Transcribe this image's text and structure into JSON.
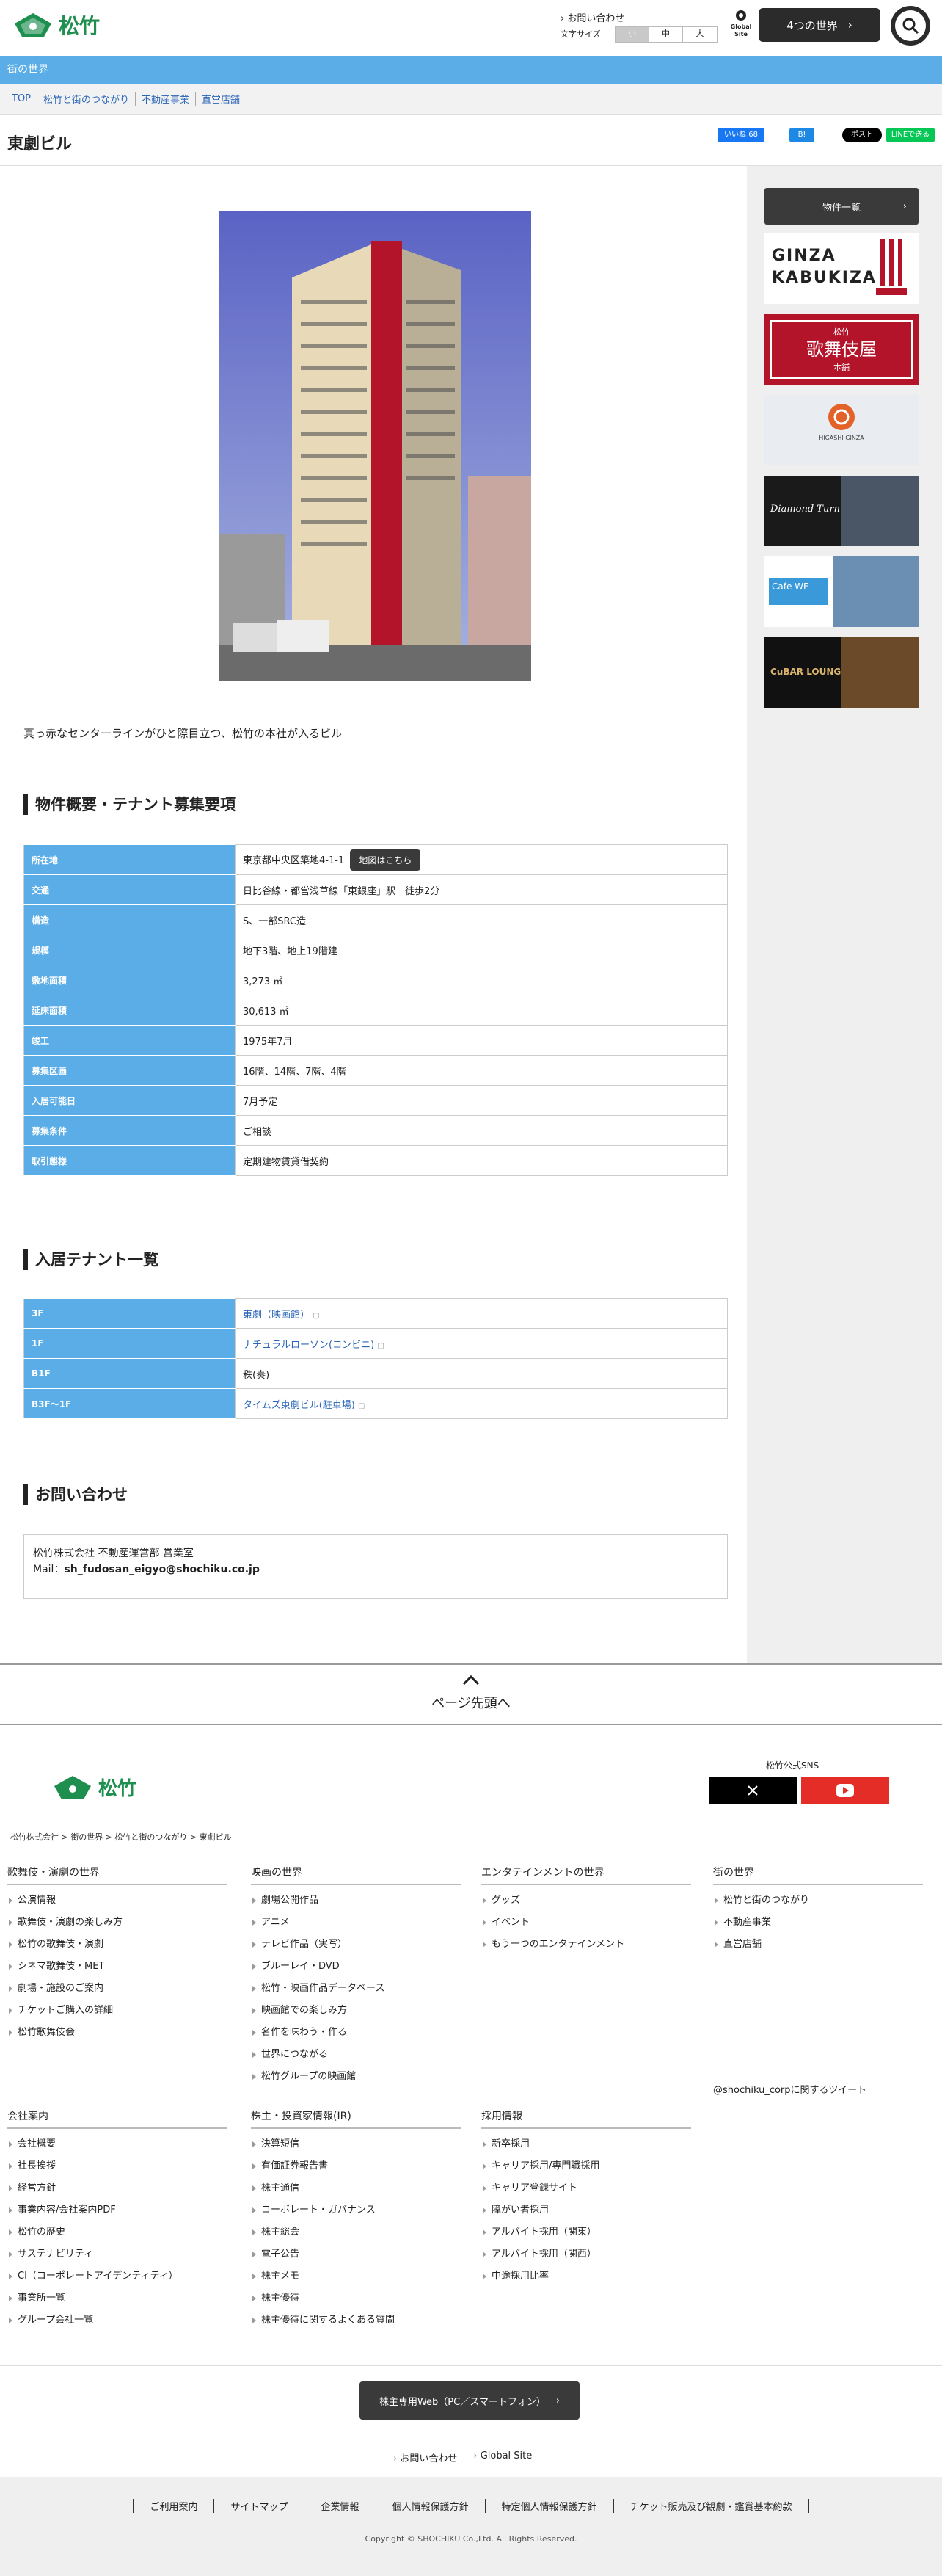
{
  "header": {
    "logo_text": "松竹",
    "contact_label": "お問い合わせ",
    "font_size_label": "文字サイズ",
    "font_sizes": [
      "小",
      "中",
      "大"
    ],
    "global_label_1": "Global",
    "global_label_2": "Site",
    "worlds_label": "4つの世界"
  },
  "band": {
    "title": "街の世界"
  },
  "breadcrumb": [
    "TOP",
    "松竹と街のつながり",
    "不動産事業",
    "直営店舗"
  ],
  "page": {
    "title": "東劇ビル"
  },
  "share": {
    "facebook": "いいね 68",
    "hatena": "B!",
    "twitter": "ポスト",
    "line": "LINEで送る"
  },
  "lead": "真っ赤なセンターラインがひと際目立つ、松竹の本社が入るビル",
  "spec_heading": "物件概要・テナント募集要項",
  "spec": [
    {
      "k": "所在地",
      "v": "東京都中央区築地4-1-1"
    },
    {
      "k": "交通",
      "v": "日比谷線・都営浅草線「東銀座」駅　徒歩2分"
    },
    {
      "k": "構造",
      "v": "S、一部SRC造"
    },
    {
      "k": "規模",
      "v": "地下3階、地上19階建"
    },
    {
      "k": "敷地面積",
      "v": "3,273 ㎡"
    },
    {
      "k": "延床面積",
      "v": "30,613 ㎡"
    },
    {
      "k": "竣工",
      "v": "1975年7月"
    },
    {
      "k": "募集区画",
      "v": "16階、14階、7階、4階"
    },
    {
      "k": "入居可能日",
      "v": "7月予定"
    },
    {
      "k": "募集条件",
      "v": "ご相談"
    },
    {
      "k": "取引態様",
      "v": "定期建物賃貸借契約"
    }
  ],
  "map_button": "地図はこちら",
  "tenant_heading": "入居テナント一覧",
  "tenants": [
    {
      "k": "3F",
      "v": "東劇（映画館）"
    },
    {
      "k": "1F",
      "v": "ナチュラルローソン(コンビニ)"
    },
    {
      "k": "B1F",
      "v": "秩(奏)"
    },
    {
      "k": "B3F〜1F",
      "v": "タイムズ東劇ビル(駐車場)"
    }
  ],
  "inquiry_heading": "お問い合わせ",
  "inquiry": {
    "dept": "松竹株式会社 不動産運営部 営業室",
    "mail_label": "Mail：",
    "mail": "sh_fudosan_eigyo@shochiku.co.jp"
  },
  "sidebar": {
    "list_button": "物件一覧",
    "banner_ginza": "GINZA",
    "banner_kabukiza": "KABUKIZA",
    "banner_kabuki_small": "松竹",
    "banner_kabuki_main": "歌舞伎屋",
    "banner_kabuki_sub": "本舗",
    "banner_higashi": "HIGASHI GINZA",
    "banner_diamond": "Diamond Turn",
    "banner_cafe": "Cafe WE",
    "banner_cubar": "CuBAR LOUNGE"
  },
  "page_top": "ページ先頭へ",
  "footer": {
    "logo_text": "松竹",
    "sns_title": "松竹公式SNS",
    "breadcrumb": "松竹株式会社 > 街の世界 > 松竹と街のつながり > 東劇ビル",
    "columns": [
      {
        "title": "歌舞伎・演劇の世界",
        "items": [
          "公演情報",
          "歌舞伎・演劇の楽しみ方",
          "松竹の歌舞伎・演劇",
          "シネマ歌舞伎・MET",
          "劇場・施設のご案内",
          "チケットご購入の詳細",
          "松竹歌舞伎会"
        ]
      },
      {
        "title": "映画の世界",
        "items": [
          "劇場公開作品",
          "アニメ",
          "テレビ作品（実写）",
          "ブルーレイ・DVD",
          "松竹・映画作品データベース",
          "映画館での楽しみ方",
          "名作を味わう・作る",
          "世界につながる",
          "松竹グループの映画館"
        ]
      },
      {
        "title": "エンタテインメントの世界",
        "items": [
          "グッズ",
          "イベント",
          "もう一つのエンタテインメント"
        ]
      },
      {
        "title": "街の世界",
        "items": [
          "松竹と街のつながり",
          "不動産事業",
          "直営店舗"
        ]
      },
      {
        "title": "会社案内",
        "items": [
          "会社概要",
          "社長挨拶",
          "経営方針",
          "事業内容/会社案内PDF",
          "松竹の歴史",
          "サステナビリティ",
          "CI（コーポレートアイデンティティ）",
          "事業所一覧",
          "グループ会社一覧"
        ]
      },
      {
        "title": "株主・投資家情報(IR)",
        "items": [
          "決算短信",
          "有価証券報告書",
          "株主通信",
          "コーポレート・ガバナンス",
          "株主総会",
          "電子公告",
          "株主メモ",
          "株主優待",
          "株主優待に関するよくある質問"
        ]
      },
      {
        "title": "採用情報",
        "items": [
          "新卒採用",
          "キャリア採用/専門職採用",
          "キャリア登録サイト",
          "障がい者採用",
          "アルバイト採用（関東）",
          "アルバイト採用（関西）",
          "中途採用比率"
        ]
      }
    ],
    "tweets": "@shochiku_corpに関するツイート",
    "shareholder_button": "株主専用Web（PC／スマートフォン）",
    "links2": [
      "お問い合わせ",
      "Global Site"
    ],
    "bottom_links": [
      "ご利用案内",
      "サイトマップ",
      "企業情報",
      "個人情報保護方針",
      "特定個人情報保護方針",
      "チケット販売及び観劇・鑑賞基本約款"
    ],
    "copyright": "Copyright © SHOCHIKU Co.,Ltd. All Rights Reserved."
  }
}
